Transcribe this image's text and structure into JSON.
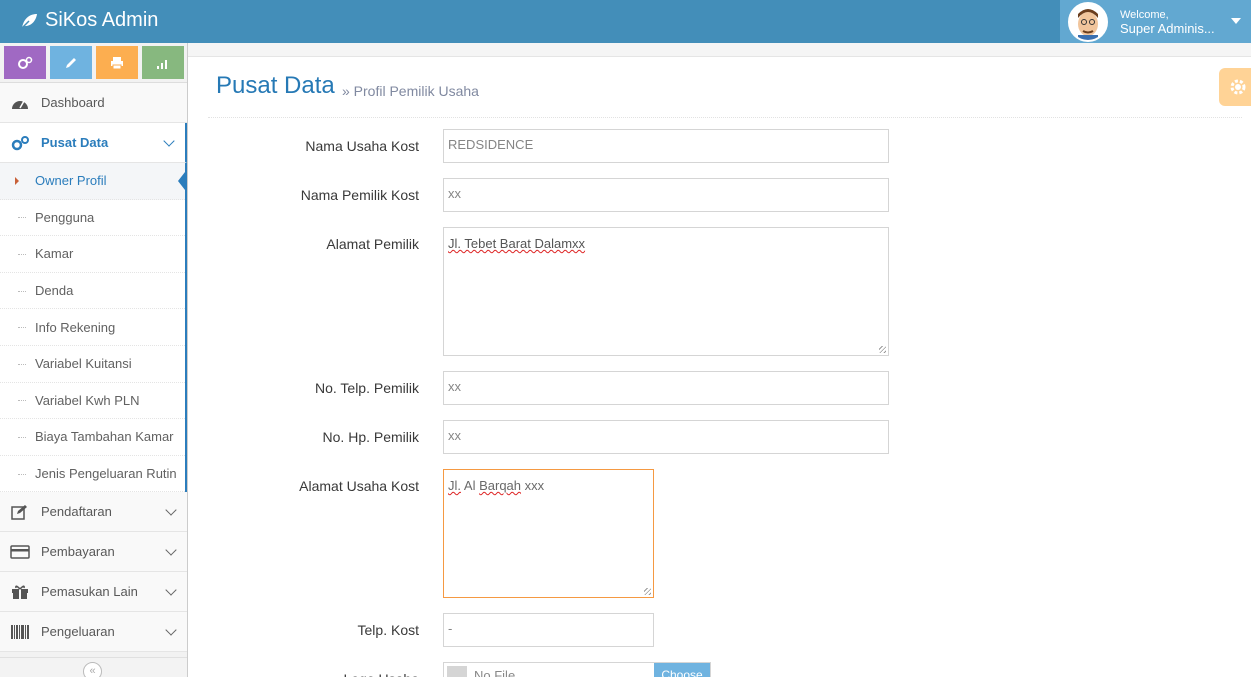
{
  "app": {
    "brand": "SiKos Admin"
  },
  "user": {
    "welcome": "Welcome,",
    "name": "Super Adminis..."
  },
  "sidebar": {
    "items": [
      {
        "label": "Dashboard",
        "icon": "tachometer-icon"
      },
      {
        "label": "Pusat Data",
        "icon": "cogs-icon",
        "active": true
      },
      {
        "label": "Pendaftaran",
        "icon": "pencil-square-icon"
      },
      {
        "label": "Pembayaran",
        "icon": "credit-card-icon"
      },
      {
        "label": "Pemasukan Lain",
        "icon": "gift-icon"
      },
      {
        "label": "Pengeluaran",
        "icon": "barcode-icon"
      }
    ],
    "submenu": [
      {
        "label": "Owner Profil",
        "active": true
      },
      {
        "label": "Pengguna"
      },
      {
        "label": "Kamar"
      },
      {
        "label": "Denda"
      },
      {
        "label": "Info Rekening"
      },
      {
        "label": "Variabel Kuitansi"
      },
      {
        "label": "Variabel Kwh PLN"
      },
      {
        "label": "Biaya Tambahan Kamar"
      },
      {
        "label": "Jenis Pengeluaran Rutin"
      }
    ]
  },
  "page": {
    "title": "Pusat Data",
    "subtitle": "» Profil Pemilik Usaha"
  },
  "form": {
    "nama_usaha": {
      "label": "Nama Usaha Kost",
      "value": "REDSIDENCE"
    },
    "nama_pemilik": {
      "label": "Nama Pemilik Kost",
      "value": "xx"
    },
    "alamat_pemilik": {
      "label": "Alamat Pemilik",
      "value_a": "Jl. Tebet Barat Dalamxx"
    },
    "telp_pemilik": {
      "label": "No. Telp. Pemilik",
      "value": "xx"
    },
    "hp_pemilik": {
      "label": "No. Hp. Pemilik",
      "value": "xx"
    },
    "alamat_usaha": {
      "label": "Alamat Usaha Kost",
      "value_a": "Jl.",
      "value_b": "Al",
      "value_c": "Barqah",
      "value_d": "xxx"
    },
    "telp_kost": {
      "label": "Telp. Kost",
      "value": "-"
    },
    "logo": {
      "label": "Logo Usaha",
      "file_text": "No File ...",
      "choose": "Choose"
    }
  },
  "colors": {
    "navbar": "#438eb9",
    "accent": "#2b7dbc",
    "focus": "#f59942"
  }
}
